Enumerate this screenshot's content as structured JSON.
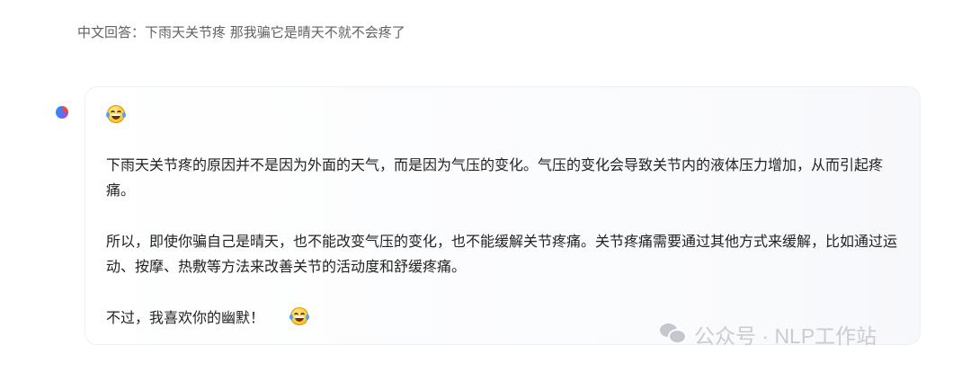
{
  "conversation": {
    "user_prompt": "中文回答：下雨天关节疼 那我骗它是晴天不就不会疼了",
    "assistant": {
      "top_emoji": "joy-emoji-icon",
      "paragraph_1": "下雨天关节疼的原因并不是因为外面的天气，而是因为气压的变化。气压的变化会导致关节内的液体压力增加，从而引起疼痛。",
      "paragraph_2": "所以，即使你骗自己是晴天，也不能改变气压的变化，也不能缓解关节疼痛。关节疼痛需要通过其他方式来缓解，比如通过运动、按摩、热敷等方法来改善关节的活动度和舒缓疼痛。",
      "paragraph_3": "不过，我喜欢你的幽默！",
      "closing_emoji": "joy-emoji-icon"
    }
  },
  "watermark": {
    "icon": "wechat-icon",
    "text": "公众号 · NLP工作站"
  },
  "colors": {
    "prompt_text": "#606266",
    "body_text": "#222222",
    "card_border": "#eef0f4",
    "watermark": "#c9ccd1"
  }
}
